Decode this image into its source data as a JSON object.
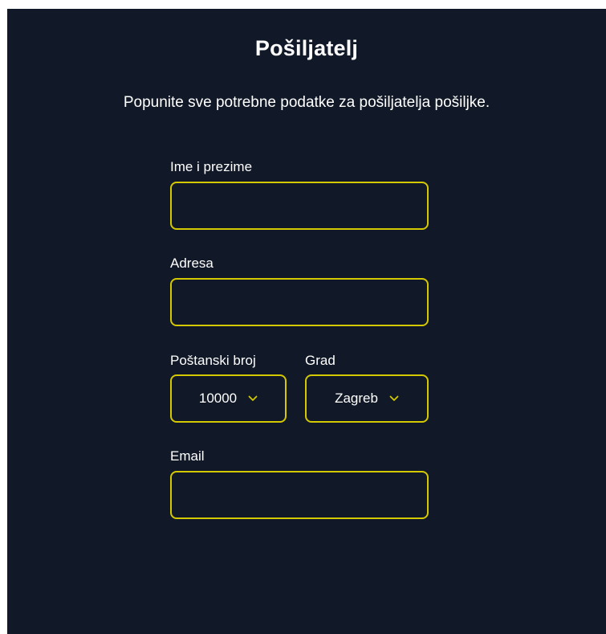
{
  "form": {
    "title": "Pošiljatelj",
    "subtitle": "Popunite sve potrebne podatke za pošiljatelja pošiljke.",
    "fields": {
      "name": {
        "label": "Ime i prezime",
        "value": "",
        "placeholder": ""
      },
      "address": {
        "label": "Adresa",
        "value": "",
        "placeholder": ""
      },
      "postal": {
        "label": "Poštanski broj",
        "selected": "10000"
      },
      "city": {
        "label": "Grad",
        "selected": "Zagreb"
      },
      "email": {
        "label": "Email",
        "value": "",
        "placeholder": ""
      }
    }
  },
  "colors": {
    "background": "#111827",
    "accent": "#d4c800",
    "text": "#ffffff"
  },
  "icons": {
    "dropdown": "chevron-down-icon"
  }
}
